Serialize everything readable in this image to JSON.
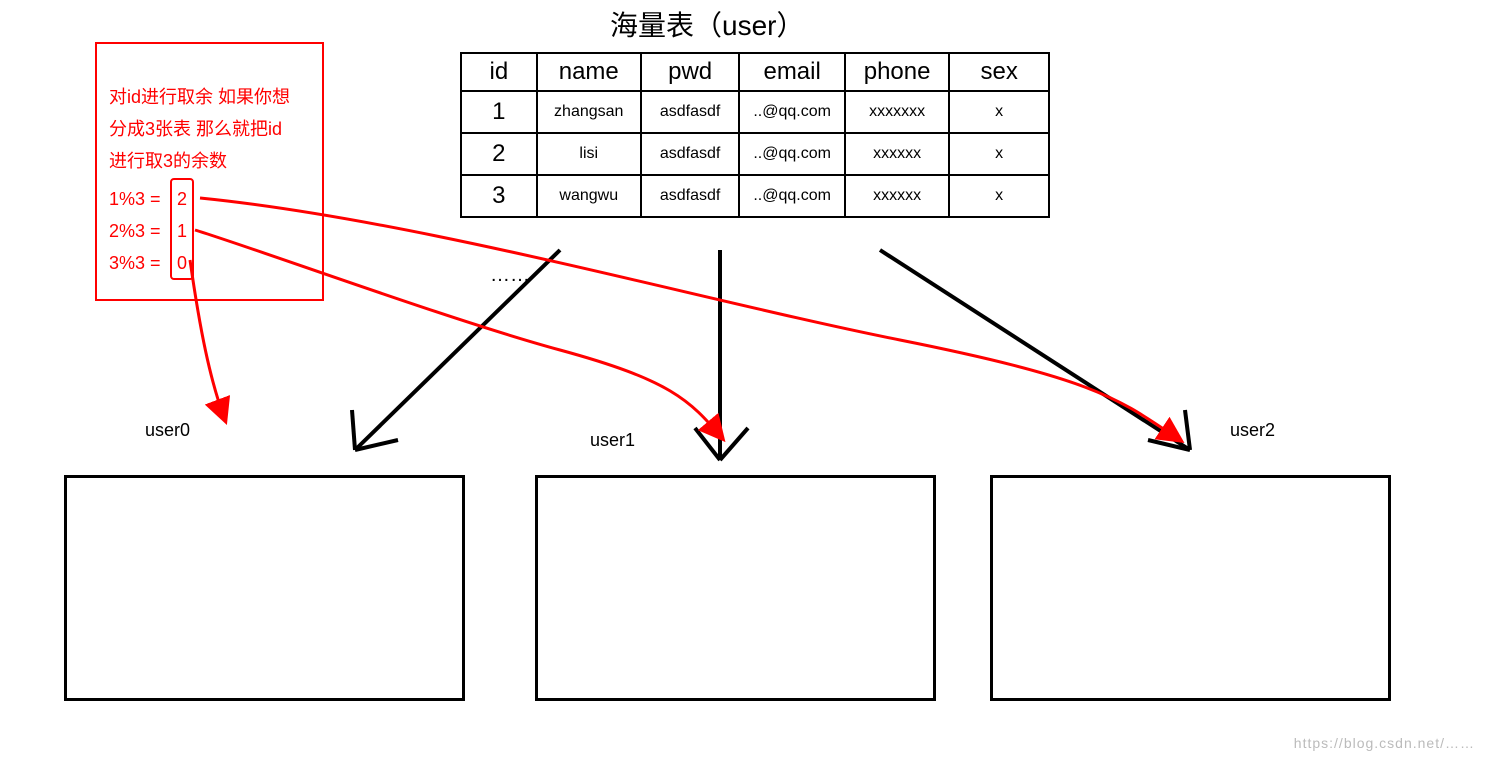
{
  "title": "海量表（user）",
  "table": {
    "headers": [
      "id",
      "name",
      "pwd",
      "email",
      "phone",
      "sex"
    ],
    "rows": [
      {
        "id": "1",
        "name": "zhangsan",
        "pwd": "asdfasdf",
        "email": "..@qq.com",
        "phone": "xxxxxxx",
        "sex": "x"
      },
      {
        "id": "2",
        "name": "lisi",
        "pwd": "asdfasdf",
        "email": "..@qq.com",
        "phone": "xxxxxx",
        "sex": "x"
      },
      {
        "id": "3",
        "name": "wangwu",
        "pwd": "asdfasdf",
        "email": "..@qq.com",
        "phone": "xxxxxx",
        "sex": "x"
      }
    ],
    "ellipsis": "……"
  },
  "redbox": {
    "line1": "对id进行取余 如果你想",
    "line2": "分成3张表 那么就把id",
    "line3": "进行取3的余数",
    "calc1_left": "1%3  =",
    "calc1_right": "2",
    "calc2_left": "2%3  =",
    "calc2_right": "1",
    "calc3_left": "3%3  =",
    "calc3_right": "0"
  },
  "subtables": {
    "u0": "user0",
    "u1": "user1",
    "u2": "user2"
  },
  "watermark": "https://blog.csdn.net/……"
}
